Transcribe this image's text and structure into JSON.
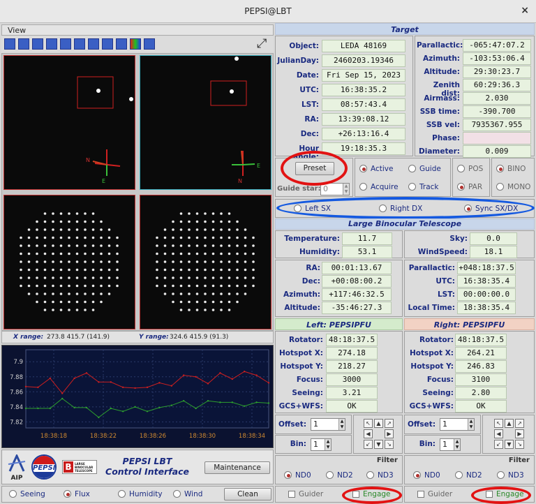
{
  "window": {
    "title": "PEPSI@LBT",
    "close": "×"
  },
  "menu": {
    "view": "View"
  },
  "toolbar": {
    "icons": [
      "zoom-in-icon",
      "zoom-out-icon",
      "pan-icon",
      "fit-icon",
      "stretch-icon",
      "rotate-icon",
      "flip-icon",
      "contrast-icon",
      "histogram-icon",
      "colormap-icon",
      "print-icon"
    ],
    "expand": "⤢"
  },
  "ranges": {
    "x_label": "X range:",
    "x_value": "273.8 415.7 (141.9)",
    "y_label": "Y range:",
    "y_value": "324.6 415.9 (91.3)"
  },
  "chart_data": {
    "type": "line",
    "x": [
      "18:38:18",
      "18:38:22",
      "18:38:26",
      "18:38:30",
      "18:38:34"
    ],
    "yticks": [
      "7.9",
      "7.88",
      "7.86",
      "7.84",
      "7.82"
    ],
    "ylim": [
      7.812,
      7.916
    ],
    "series": [
      {
        "values": [
          7.867,
          7.866,
          7.878,
          7.858,
          7.878,
          7.885,
          7.873,
          7.873,
          7.866,
          7.865,
          7.866,
          7.872,
          7.868,
          7.882,
          7.88,
          7.871,
          7.885,
          7.877,
          7.887,
          7.882,
          7.872
        ]
      },
      {
        "values": [
          7.838,
          7.838,
          7.838,
          7.851,
          7.839,
          7.839,
          7.826,
          7.838,
          7.834,
          7.84,
          7.834,
          7.839,
          7.842,
          7.848,
          7.838,
          7.848,
          7.846,
          7.846,
          7.841,
          7.846,
          7.845
        ]
      }
    ],
    "colors": [
      "#cc1f1f",
      "#2ea02e"
    ]
  },
  "logos": {
    "aip": "AIP",
    "pepsi": "PEPSI",
    "lbt": "LARGE BINOCULAR TELESCOPE",
    "title1": "PEPSI LBT",
    "title2": "Control Interface"
  },
  "maintenance": "Maintenance",
  "bottom": {
    "seeing": "Seeing",
    "flux": "Flux",
    "humidity": "Humidity",
    "wind": "Wind",
    "clean": "Clean"
  },
  "target": {
    "header": "Target",
    "left": [
      {
        "l": "Object:",
        "v": "LEDA 48169"
      },
      {
        "l": "JulianDay:",
        "v": "2460203.19346"
      },
      {
        "l": "Date:",
        "v": "Fri Sep 15, 2023"
      },
      {
        "l": "UTC:",
        "v": "16:38:35.2"
      },
      {
        "l": "LST:",
        "v": "08:57:43.4"
      },
      {
        "l": "RA:",
        "v": "13:39:08.12"
      },
      {
        "l": "Dec:",
        "v": "+26:13:16.4"
      },
      {
        "l": "Hour angle:",
        "v": "19:18:35.3"
      }
    ],
    "right": [
      {
        "l": "Parallactic:",
        "v": "-065:47:07.2"
      },
      {
        "l": "Azimuth:",
        "v": "-103:53:06.4"
      },
      {
        "l": "Altitude:",
        "v": "29:30:23.7"
      },
      {
        "l": "Zenith dist:",
        "v": "60:29:36.3"
      },
      {
        "l": "Airmass:",
        "v": "2.030"
      },
      {
        "l": "SSB time:",
        "v": "-390.700"
      },
      {
        "l": "SSB vel:",
        "v": "7935367.955"
      },
      {
        "l": "Phase:",
        "v": ""
      },
      {
        "l": "Diameter:",
        "v": "0.009"
      }
    ]
  },
  "preset": {
    "button": "Preset",
    "guide_star": "Guide star:",
    "guide_value": "0",
    "active": "Active",
    "guide": "Guide",
    "acquire": "Acquire",
    "track": "Track",
    "pos": "POS",
    "par": "PAR",
    "bino": "BINO",
    "mono": "MONO"
  },
  "side": {
    "left": "Left SX",
    "right": "Right DX",
    "sync": "Sync SX/DX"
  },
  "lbt": {
    "header": "Large Binocular Telescope",
    "env": [
      {
        "l": "Temperature:",
        "v": "11.7"
      },
      {
        "l": "Humidity:",
        "v": "53.1"
      }
    ],
    "env2": [
      {
        "l": "Sky:",
        "v": "0.0"
      },
      {
        "l": "WindSpeed:",
        "v": "18.1"
      }
    ],
    "pos": [
      {
        "l": "RA:",
        "v": "00:01:13.67"
      },
      {
        "l": "Dec:",
        "v": "+00:08:00.2"
      },
      {
        "l": "Azimuth:",
        "v": "+117:46:32.5"
      },
      {
        "l": "Altitude:",
        "v": "-35:46:27.3"
      }
    ],
    "time": [
      {
        "l": "Parallactic:",
        "v": "+048:18:37.5"
      },
      {
        "l": "UTC:",
        "v": "16:38:35.4"
      },
      {
        "l": "LST:",
        "v": "00:00:00.0"
      },
      {
        "l": "Local Time:",
        "v": "18:38:35.4"
      }
    ]
  },
  "leftfu": {
    "header": "Left: PEPSIPFU",
    "rows": [
      {
        "l": "Rotator:",
        "v": "48:18:37.5"
      },
      {
        "l": "Hotspot X:",
        "v": "274.18"
      },
      {
        "l": "Hotspot Y:",
        "v": "218.27"
      },
      {
        "l": "Focus:",
        "v": "3000"
      },
      {
        "l": "Seeing:",
        "v": "3.21"
      },
      {
        "l": "GCS+WFS:",
        "v": "OK"
      }
    ],
    "offset": "Offset:",
    "offset_v": "1",
    "bin": "Bin:",
    "bin_v": "1"
  },
  "rightfu": {
    "header": "Right: PEPSIPFU",
    "rows": [
      {
        "l": "Rotator:",
        "v": "48:18:37.5"
      },
      {
        "l": "Hotspot X:",
        "v": "264.21"
      },
      {
        "l": "Hotspot Y:",
        "v": "246.83"
      },
      {
        "l": "Focus:",
        "v": "3100"
      },
      {
        "l": "Seeing:",
        "v": "2.80"
      },
      {
        "l": "GCS+WFS:",
        "v": "OK"
      }
    ],
    "offset": "Offset:",
    "offset_v": "1",
    "bin": "Bin:",
    "bin_v": "1"
  },
  "filter": {
    "label": "Filter",
    "nd0": "ND0",
    "nd2": "ND2",
    "nd3": "ND3",
    "guider": "Guider",
    "engage": "Engage"
  },
  "cams": {
    "n": "N",
    "e": "E"
  }
}
